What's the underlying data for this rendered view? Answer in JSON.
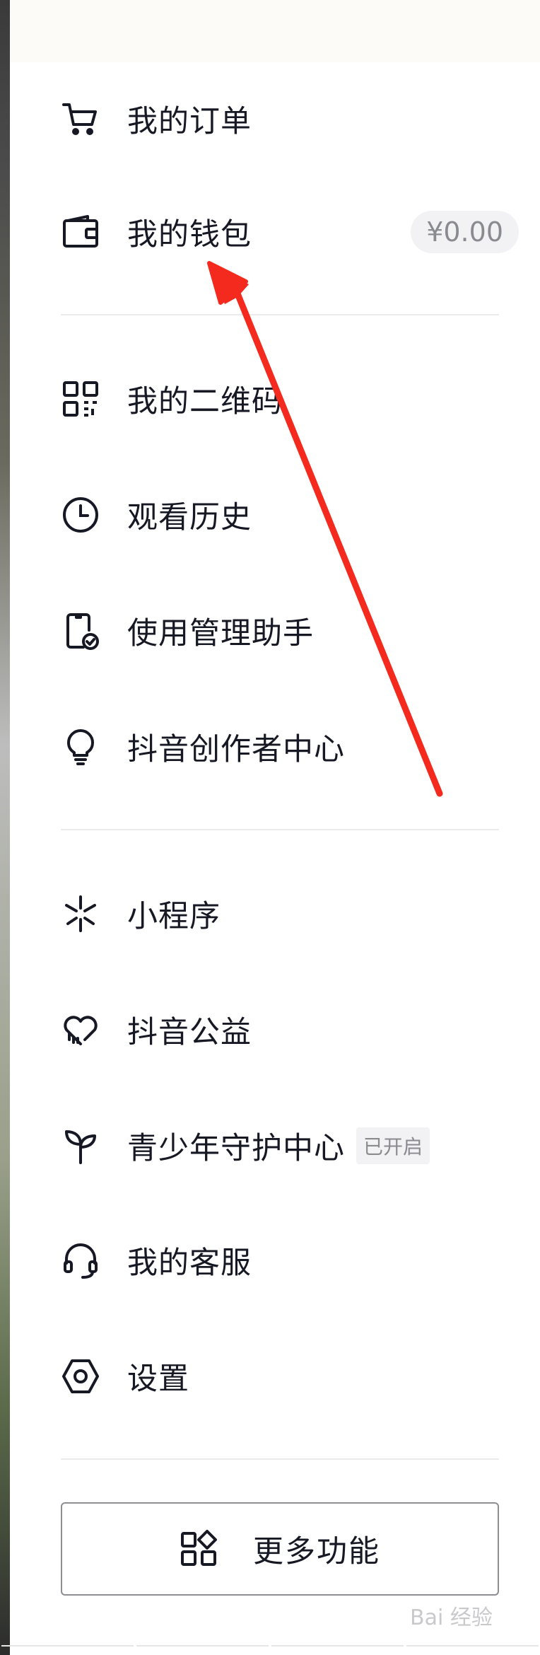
{
  "menu": {
    "orders_label": "我的订单",
    "wallet_label": "我的钱包",
    "wallet_balance": "¥0.00",
    "qrcode_label": "我的二维码",
    "history_label": "观看历史",
    "phone_assistant_label": "使用管理助手",
    "creator_center_label": "抖音创作者中心",
    "mini_program_label": "小程序",
    "charity_label": "抖音公益",
    "youth_protection_label": "青少年守护中心",
    "youth_protection_status": "已开启",
    "customer_service_label": "我的客服",
    "settings_label": "设置"
  },
  "more_button_label": "更多功能",
  "watermark": "Bai 经验",
  "colors": {
    "text": "#161823",
    "badge_bg": "#f2f2f4",
    "badge_text": "#8a8b91",
    "divider": "#ebebed",
    "annotation_arrow": "#f42a1e"
  }
}
